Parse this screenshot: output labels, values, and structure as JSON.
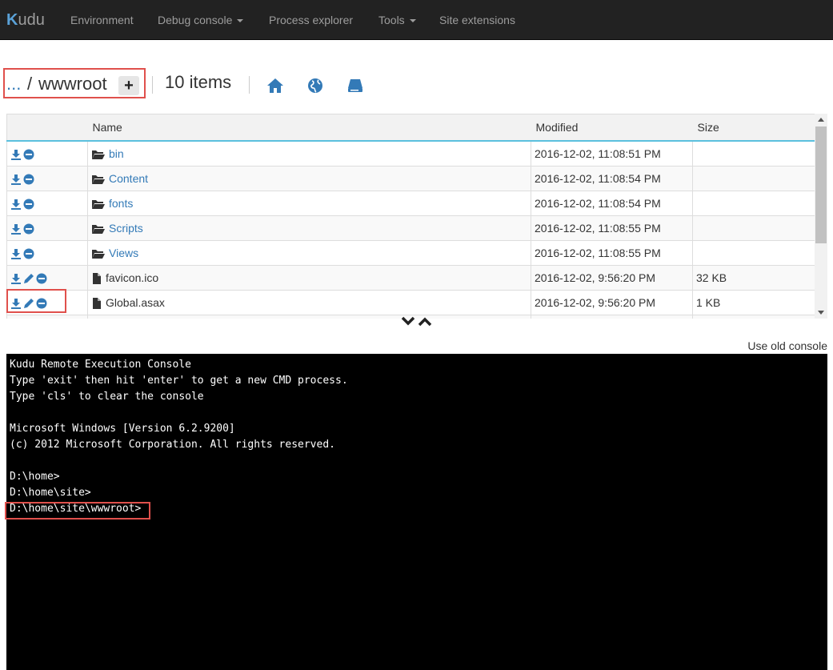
{
  "nav": {
    "brand": "Kudu",
    "items": [
      {
        "label": "Environment"
      },
      {
        "label": "Debug console",
        "dropdown": true
      },
      {
        "label": "Process explorer"
      },
      {
        "label": "Tools",
        "dropdown": true
      },
      {
        "label": "Site extensions"
      }
    ]
  },
  "breadcrumb": {
    "parent": "...",
    "separator": "/",
    "current": "wwwroot",
    "add_label": "+",
    "item_count": "10 items"
  },
  "table": {
    "headers": {
      "name": "Name",
      "modified": "Modified",
      "size": "Size"
    },
    "rows": [
      {
        "name": "bin",
        "type": "folder",
        "modified": "2016-12-02, 11:08:51 PM",
        "size": ""
      },
      {
        "name": "Content",
        "type": "folder",
        "modified": "2016-12-02, 11:08:54 PM",
        "size": ""
      },
      {
        "name": "fonts",
        "type": "folder",
        "modified": "2016-12-02, 11:08:54 PM",
        "size": ""
      },
      {
        "name": "Scripts",
        "type": "folder",
        "modified": "2016-12-02, 11:08:55 PM",
        "size": ""
      },
      {
        "name": "Views",
        "type": "folder",
        "modified": "2016-12-02, 11:08:55 PM",
        "size": ""
      },
      {
        "name": "favicon.ico",
        "type": "file",
        "modified": "2016-12-02, 9:56:20 PM",
        "size": "32 KB"
      },
      {
        "name": "Global.asax",
        "type": "file",
        "modified": "2016-12-02, 9:56:20 PM",
        "size": "1 KB"
      }
    ]
  },
  "use_old_console": "Use old console",
  "console": {
    "lines": [
      "Kudu Remote Execution Console",
      "Type 'exit' then hit 'enter' to get a new CMD process.",
      "Type 'cls' to clear the console",
      "",
      "Microsoft Windows [Version 6.2.9200]",
      "(c) 2012 Microsoft Corporation. All rights reserved.",
      "",
      "D:\\home>",
      "D:\\home\\site>",
      "D:\\home\\site\\wwwroot>"
    ]
  },
  "colors": {
    "accent": "#337ab7",
    "highlight": "#e0504c",
    "navbar": "#222222"
  }
}
